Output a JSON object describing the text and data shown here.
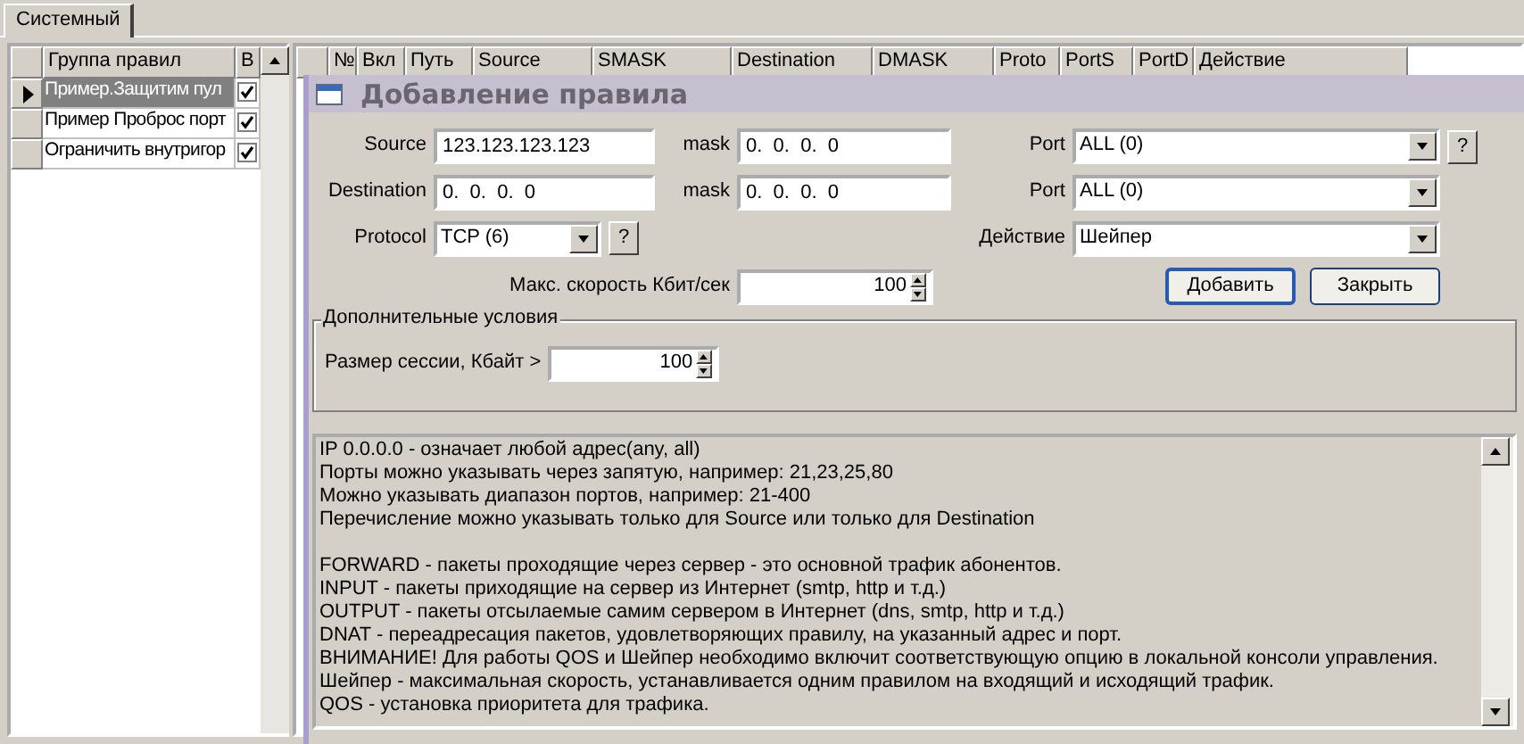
{
  "tabs": [
    {
      "label": "Системный",
      "selected": true
    }
  ],
  "groups_table": {
    "columns": [
      "Группа правил",
      "В"
    ],
    "rows": [
      {
        "name": "Пример.Защитим пул",
        "enabled": true,
        "selected": true
      },
      {
        "name": "Пример Проброс порт",
        "enabled": true,
        "selected": false
      },
      {
        "name": "Ограничить внутригор",
        "enabled": true,
        "selected": false
      }
    ]
  },
  "rules_table": {
    "columns": [
      "№",
      "Вкл",
      "Путь",
      "Source",
      "SMASK",
      "Destination",
      "DMASK",
      "Proto",
      "PortS",
      "PortD",
      "Действие"
    ]
  },
  "dialog": {
    "title": "Добавление правила",
    "source": {
      "label": "Source",
      "value": "123.123.123.123"
    },
    "source_mask": {
      "label": "mask",
      "value": "0.  0.  0.  0"
    },
    "source_port": {
      "label": "Port",
      "value": "ALL (0)"
    },
    "port_help": "?",
    "destination": {
      "label": "Destination",
      "value": "0.  0.  0.  0"
    },
    "destination_mask": {
      "label": "mask",
      "value": "0.  0.  0.  0"
    },
    "destination_port": {
      "label": "Port",
      "value": "ALL (0)"
    },
    "protocol": {
      "label": "Protocol",
      "value": "TCP (6)"
    },
    "protocol_help": "?",
    "action": {
      "label": "Действие",
      "value": "Шейпер"
    },
    "max_speed": {
      "label": "Макс. скорость Кбит/сек",
      "value": "100"
    },
    "buttons": [
      {
        "label": "Добавить",
        "default": true
      },
      {
        "label": "Закрыть",
        "default": false
      }
    ],
    "extra_conditions": {
      "title": "Дополнительные условия",
      "session_size": {
        "label": "Размер сессии, Кбайт >",
        "value": "100"
      }
    },
    "help_blocks": [
      [
        "IP 0.0.0.0 - означает любой адрес(any, all)",
        "Порты можно указывать через запятую, например: 21,23,25,80",
        "Можно указывать диапазон портов, например: 21-400",
        "Перечисление можно указывать только для Source или только для Destination"
      ],
      [
        "FORWARD - пакеты проходящие через сервер - это основной трафик абонентов.",
        "INPUT - пакеты приходящие на сервер из Интернет (smtp, http и т.д.)",
        "OUTPUT - пакеты отсылаемые самим сервером в Интернет (dns, smtp, http и т.д.)",
        "DNAT - переадресация пакетов, удовлетворяющих правилу, на указанный адрес и порт.",
        "ВНИМАНИЕ! Для работы QOS и Шейпер необходимо включит соответствующую опцию в локальной консоли управления.",
        "Шейпер - максимальная скорость, устанавливается одним правилом на входящий и исходящий трафик.",
        "QOS - установка приоритета для трафика."
      ]
    ]
  }
}
